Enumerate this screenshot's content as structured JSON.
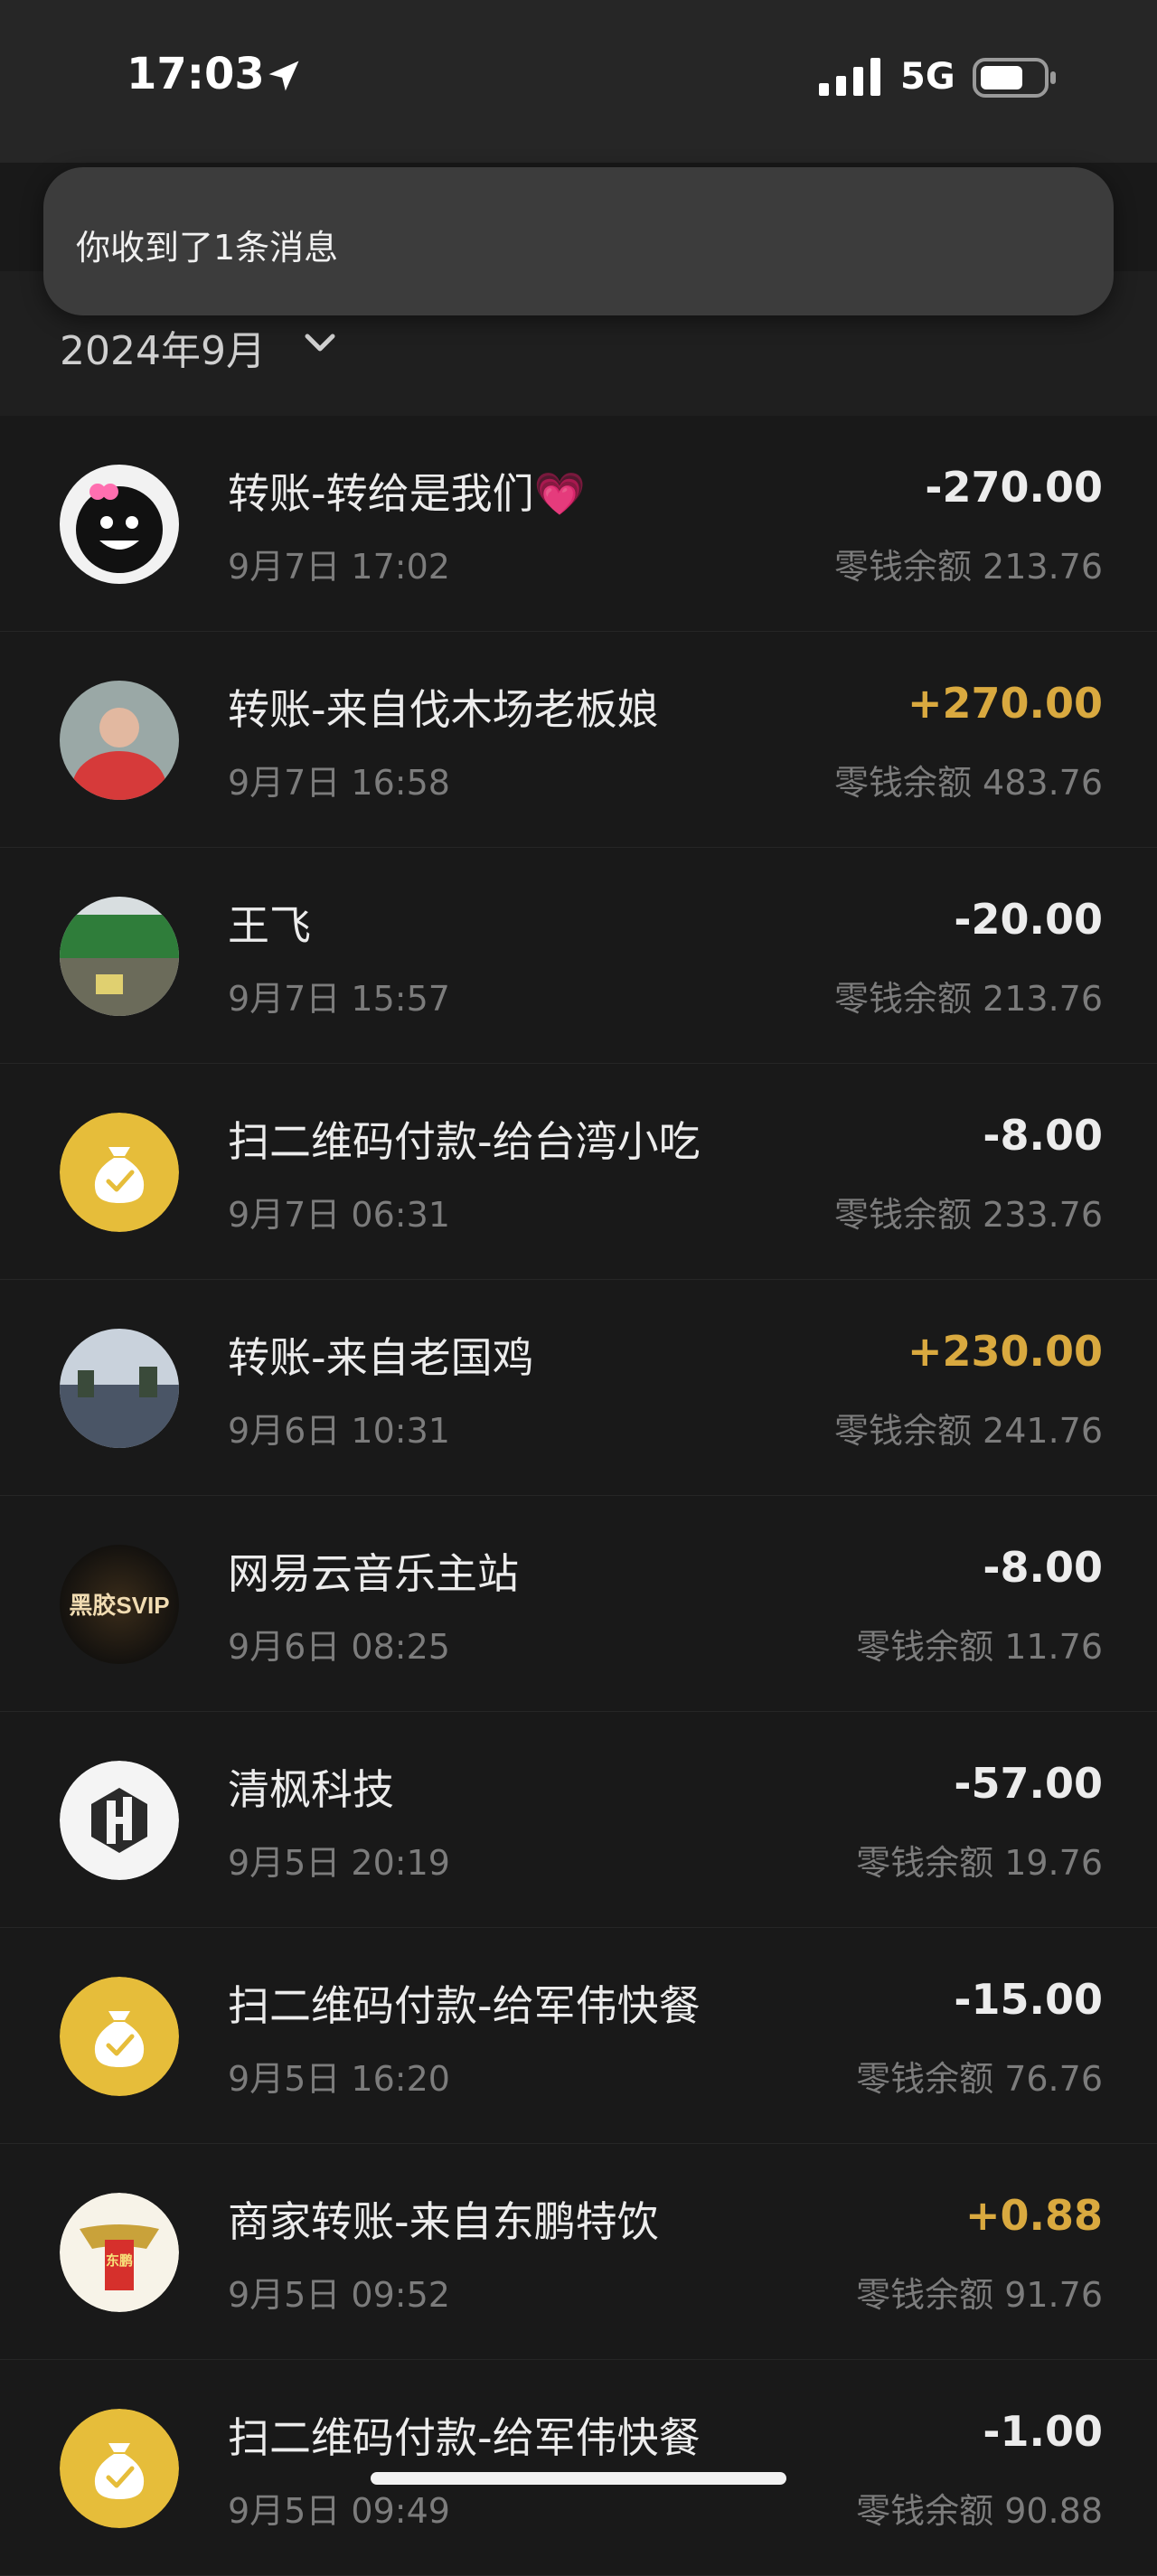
{
  "status_bar": {
    "time": "17:03",
    "network": "5G",
    "location_icon": "location-arrow-icon",
    "signal_icon": "cellular-signal-icon",
    "battery_icon": "battery-icon"
  },
  "toast": {
    "text": "你收到了1条消息"
  },
  "month_filter": {
    "label": "2024年9月",
    "icon": "chevron-down-icon"
  },
  "colors": {
    "income": "#d9a93f",
    "expense": "#ececec",
    "merchant_gold": "#e6bd3a"
  },
  "transactions": [
    {
      "title": "转账-转给是我们💗",
      "time": "9月7日 17:02",
      "amount": "-270.00",
      "type": "expense",
      "balance": "零钱余额 213.76",
      "avatar": "black-cat-avatar"
    },
    {
      "title": "转账-来自伐木场老板娘",
      "time": "9月7日 16:58",
      "amount": "+270.00",
      "type": "income",
      "balance": "零钱余额 483.76",
      "avatar": "photo-woman-avatar"
    },
    {
      "title": "王飞",
      "time": "9月7日 15:57",
      "amount": "-20.00",
      "type": "expense",
      "balance": "零钱余额 213.76",
      "avatar": "shop-sign-avatar"
    },
    {
      "title": "扫二维码付款-给台湾小吃",
      "time": "9月7日 06:31",
      "amount": "-8.00",
      "type": "expense",
      "balance": "零钱余额 233.76",
      "avatar": "money-bag-icon"
    },
    {
      "title": "转账-来自老国鸡",
      "time": "9月6日 10:31",
      "amount": "+230.00",
      "type": "income",
      "balance": "零钱余额 241.76",
      "avatar": "landscape-photo-avatar"
    },
    {
      "title": "网易云音乐主站",
      "time": "9月6日 08:25",
      "amount": "-8.00",
      "type": "expense",
      "balance": "零钱余额 11.76",
      "avatar": "svip-logo",
      "logo_text": "黑胶SVIP"
    },
    {
      "title": "清枫科技",
      "time": "9月5日 20:19",
      "amount": "-57.00",
      "type": "expense",
      "balance": "零钱余额 19.76",
      "avatar": "hexagon-logo"
    },
    {
      "title": "扫二维码付款-给军伟快餐",
      "time": "9月5日 16:20",
      "amount": "-15.00",
      "type": "expense",
      "balance": "零钱余额 76.76",
      "avatar": "money-bag-icon"
    },
    {
      "title": "商家转账-来自东鹏特饮",
      "time": "9月5日 09:52",
      "amount": "+0.88",
      "type": "income",
      "balance": "零钱余额 91.76",
      "avatar": "dongpeng-logo",
      "logo_text": "东鹏"
    },
    {
      "title": "扫二维码付款-给军伟快餐",
      "time": "9月5日 09:49",
      "amount": "-1.00",
      "type": "expense",
      "balance": "零钱余额 90.88",
      "avatar": "money-bag-icon"
    }
  ]
}
